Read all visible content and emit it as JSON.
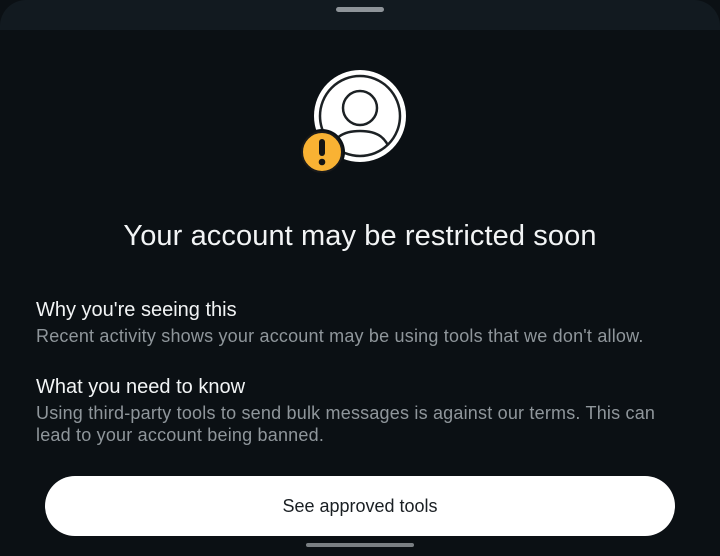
{
  "sheet": {
    "background_color": "#0b1014",
    "handle_icon": "drag-handle"
  },
  "illustration": {
    "avatar_icon": "user-avatar-icon",
    "badge_icon": "warning-exclamation-icon",
    "badge_color": "#f9b233"
  },
  "title": "Your account may be restricted soon",
  "sections": [
    {
      "heading": "Why you're seeing this",
      "body": "Recent activity shows your account may be using tools that we don't allow."
    },
    {
      "heading": "What you need to know",
      "body": "Using third-party tools to send bulk messages is against our terms. This can lead to your account being banned."
    }
  ],
  "primary_button": {
    "label": "See approved tools",
    "background_color": "#ffffff"
  }
}
